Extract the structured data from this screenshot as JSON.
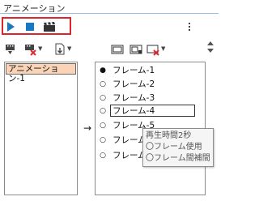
{
  "panel": {
    "title": "アニメーション"
  },
  "playback": {
    "play_icon": "play-icon",
    "stop_icon": "stop-icon",
    "clapper_icon": "clapper-icon"
  },
  "toolbar": {
    "more_icon": "kebab-menu-icon"
  },
  "animations": [
    {
      "label": "アニメーション-1",
      "selected": true
    }
  ],
  "arrow": "→",
  "frames": [
    {
      "label": "フレーム-1",
      "bullet": "●"
    },
    {
      "label": "フレーム-2",
      "bullet": "○"
    },
    {
      "label": "フレーム-3",
      "bullet": "○"
    },
    {
      "label": "フレーム-4",
      "bullet": "○",
      "selected": true
    },
    {
      "label": "フレーム-5",
      "bullet": "○"
    },
    {
      "label": "フレーム-6",
      "bullet": "○"
    },
    {
      "label": "フレーム-7",
      "bullet": "○"
    }
  ],
  "tooltip": {
    "line1": "再生時間2秒",
    "line2": "〇フレーム使用",
    "line3": "〇フレーム間補間"
  },
  "colors": {
    "accent": "#1a78c2",
    "highlight_border": "#e0242c",
    "selected_anim_bg": "#fbd3b6",
    "delete_x": "#e0242c"
  }
}
